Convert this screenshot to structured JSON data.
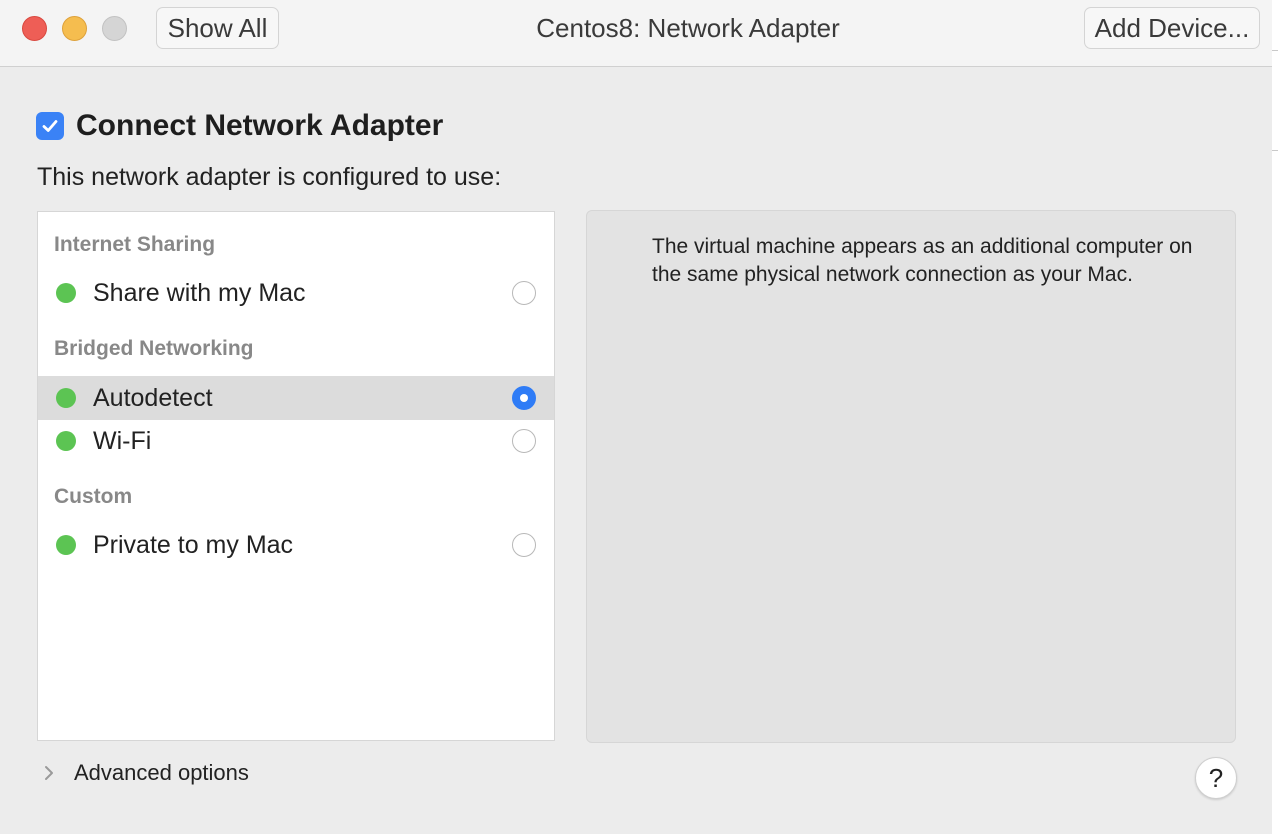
{
  "titlebar": {
    "title": "Centos8: Network Adapter",
    "show_all_label": "Show All",
    "add_device_label": "Add Device..."
  },
  "connect": {
    "label": "Connect Network Adapter",
    "checked": true
  },
  "config_label": "This network adapter is configured to use:",
  "sections": [
    {
      "header": "Internet Sharing",
      "items": [
        {
          "label": "Share with my Mac",
          "selected": false,
          "status_color": "#5cc453"
        }
      ]
    },
    {
      "header": "Bridged Networking",
      "items": [
        {
          "label": "Autodetect",
          "selected": true,
          "status_color": "#5cc453"
        },
        {
          "label": "Wi-Fi",
          "selected": false,
          "status_color": "#5cc453"
        }
      ]
    },
    {
      "header": "Custom",
      "items": [
        {
          "label": "Private to my Mac",
          "selected": false,
          "status_color": "#5cc453"
        }
      ]
    }
  ],
  "description": "The virtual machine appears as an additional computer on the same physical network connection as your Mac.",
  "advanced_label": "Advanced options",
  "help_label": "?",
  "colors": {
    "accent": "#3a82f6",
    "status_green": "#5cc453",
    "close": "#ee5e56",
    "minimize": "#f5bd4f",
    "zoom_disabled": "#d5d5d5"
  }
}
